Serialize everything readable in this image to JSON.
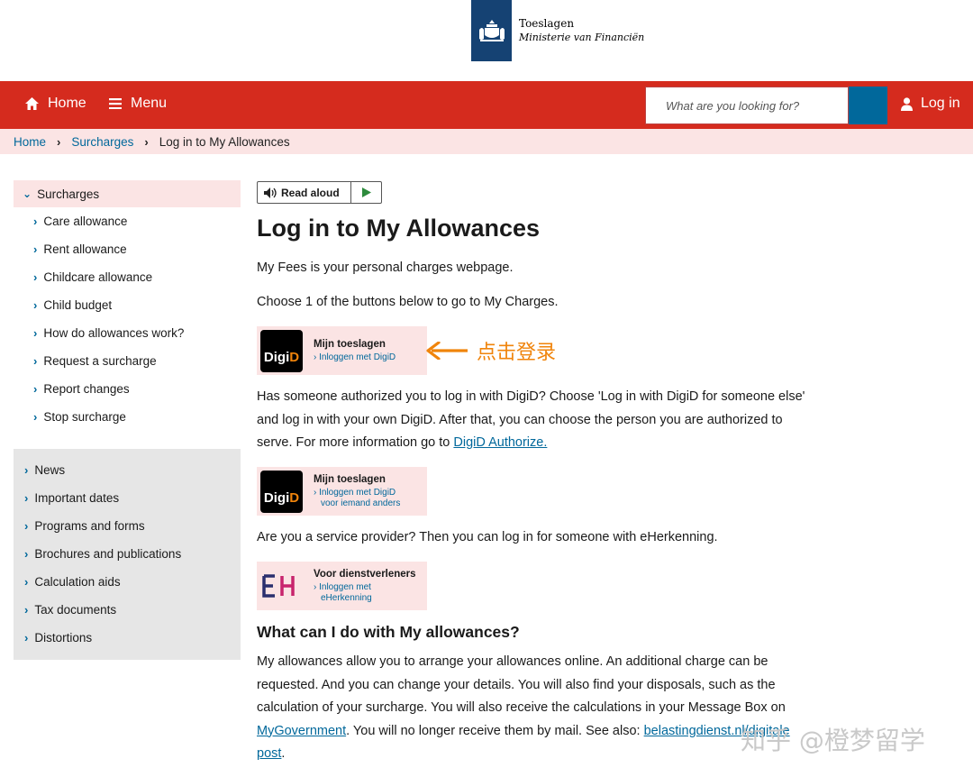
{
  "brand": {
    "name": "Toeslagen",
    "subtitle": "Ministerie van Financiën"
  },
  "header": {
    "home_label": "Home",
    "menu_label": "Menu",
    "search_placeholder": "What are you looking for?",
    "login_label": "Log in",
    "colors": {
      "bar": "#d52b1e",
      "search_button": "#01689b"
    }
  },
  "breadcrumb": {
    "items": [
      "Home",
      "Surcharges"
    ],
    "current": "Log in to My Allowances"
  },
  "sidebar": {
    "section_title": "Surcharges",
    "items": [
      "Care allowance",
      "Rent allowance",
      "Childcare allowance",
      "Child budget",
      "How do allowances work?",
      "Request a surcharge",
      "Report changes",
      "Stop surcharge"
    ],
    "secondary_items": [
      "News",
      "Important dates",
      "Programs and forms",
      "Brochures and publications",
      "Calculation aids",
      "Tax documents",
      "Distortions"
    ]
  },
  "main": {
    "read_aloud_label": "Read aloud",
    "title": "Log in to My Allowances",
    "intro": "My Fees is your personal charges webpage.",
    "choose": "Choose 1 of the buttons below to go to My Charges.",
    "tile1": {
      "title": "Mijn toeslagen",
      "sub": "› Inloggen met DigiD",
      "logo_a": "Digi",
      "logo_b": "D"
    },
    "annotation": "点击登录",
    "authorized_text": "Has someone authorized you to log in with DigiD? Choose 'Log in with DigiD for someone else' and log in with your own DigiD. After that, you can choose the person you are authorized to serve. For more information go to",
    "authorized_link": "DigiD Authorize.",
    "tile2": {
      "title": "Mijn toeslagen",
      "sub1": "› Inloggen met DigiD",
      "sub2": "voor iemand anders",
      "logo_a": "Digi",
      "logo_b": "D"
    },
    "provider_text": "Are you a service provider? Then you can log in for someone with eHerkenning.",
    "tile3": {
      "title": "Voor dienstverleners",
      "sub1": "› Inloggen met",
      "sub2": "eHerkenning"
    },
    "subheading": "What can I do with My allowances?",
    "body_text_1": "My allowances allow you to arrange your allowances online. An additional charge can be requested. And you can change your details. You will also find your disposals, such as the calculation of your surcharge. You will also receive the calculations in your Message Box on",
    "body_link_1": "MyGovernment",
    "body_text_2": ". You will no longer receive them by mail. See also:",
    "body_link_2": "belastingdienst.nl/digitale post",
    "body_text_3": "."
  },
  "watermark": "知乎 @橙梦留学"
}
